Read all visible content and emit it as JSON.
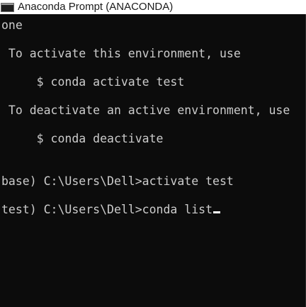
{
  "window": {
    "title": "Anaconda Prompt (ANACONDA)",
    "icon": "console-window-icon"
  },
  "console": {
    "lines": [
      "one",
      " To activate this environment, use",
      "     $ conda activate test",
      " To deactivate an active environment, use",
      "     $ conda deactivate",
      "base) C:\\Users\\Dell>activate test",
      "test) C:\\Users\\Dell>conda list"
    ],
    "cursor": "underscore"
  },
  "colors": {
    "background": "#0c0c0c",
    "text": "#cccccc",
    "titlebar": "#ffffff"
  }
}
